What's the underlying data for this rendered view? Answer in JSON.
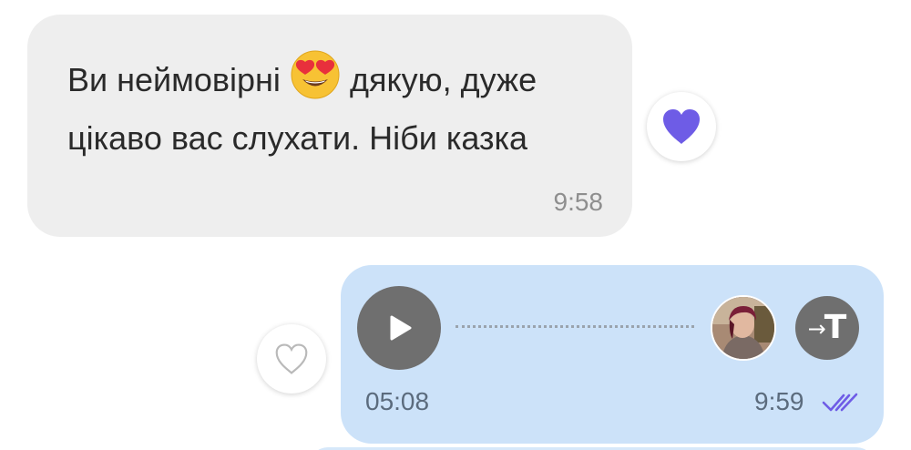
{
  "incoming_message": {
    "text_before_emoji": "Ви неймовірні",
    "emoji": "heart-eyes-emoji",
    "text_after_emoji": "дякую, дуже цікаво вас слухати. Ніби казка",
    "time": "9:58",
    "reaction": "heart-filled-icon",
    "reaction_color": "#6e5ce6"
  },
  "voice_message": {
    "duration": "05:08",
    "time": "9:59",
    "status": "read-double-check-icon",
    "play_icon": "play-icon",
    "transcribe_icon": "transcribe-icon",
    "transcribe_label": "→T",
    "bubble_color": "#cce2f9",
    "reaction": "heart-outline-icon"
  },
  "colors": {
    "incoming_bubble": "#eeeeee",
    "accent": "#6e5ce6"
  }
}
